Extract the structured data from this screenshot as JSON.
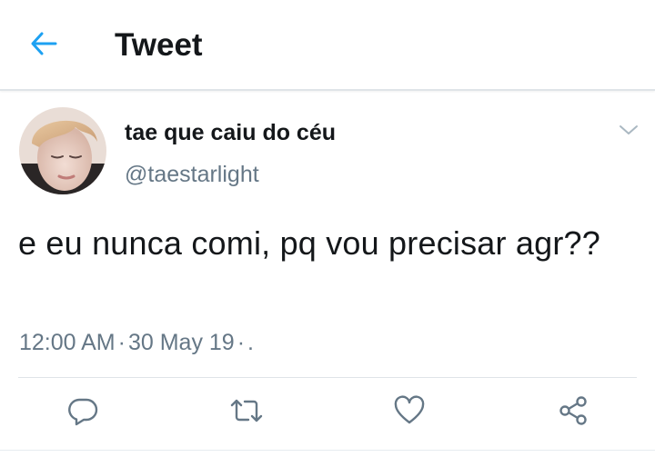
{
  "header": {
    "title": "Tweet",
    "back_icon": "arrow-left-icon"
  },
  "tweet": {
    "display_name": "tae que caiu do céu",
    "handle": "@taestarlight",
    "text": "e eu nunca comi, pq vou precisar agr??",
    "time": "12:00 AM",
    "date": "30 May 19",
    "meta_tail": "·",
    "meta_end": "."
  },
  "actions": [
    "reply-icon",
    "retweet-icon",
    "like-icon",
    "share-icon"
  ],
  "colors": {
    "accent": "#1da1f2",
    "text_primary": "#14171a",
    "text_secondary": "#657786",
    "divider": "#dfe4e8"
  }
}
